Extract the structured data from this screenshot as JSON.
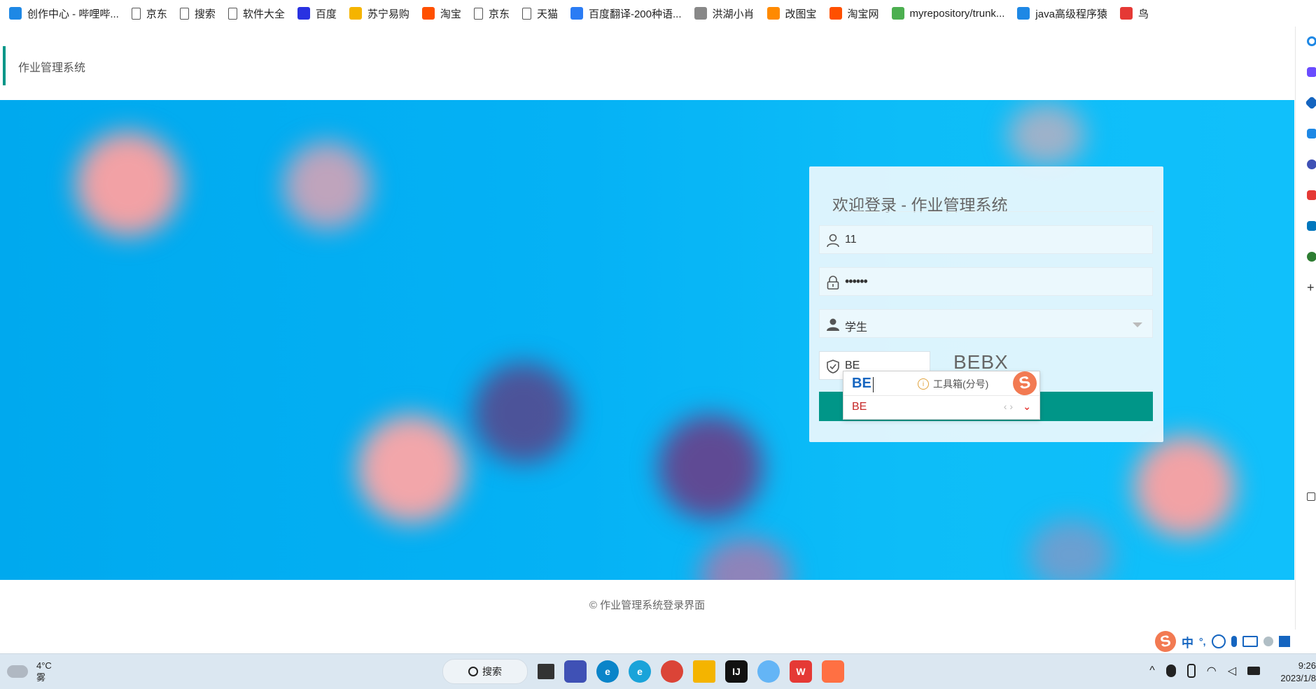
{
  "bookmarks": [
    {
      "label": "创作中心 - 哔哩哔...",
      "icon": "bilibili-icon",
      "color": "#1e88e5"
    },
    {
      "label": "京东",
      "icon": "page-icon"
    },
    {
      "label": "搜索",
      "icon": "page-icon"
    },
    {
      "label": "软件大全",
      "icon": "page-icon"
    },
    {
      "label": "百度",
      "icon": "baidu-paw-icon",
      "color": "#2932e1"
    },
    {
      "label": "苏宁易购",
      "icon": "suning-icon",
      "color": "#f5b400"
    },
    {
      "label": "淘宝",
      "icon": "taobao-icon",
      "color": "#ff5000"
    },
    {
      "label": "京东",
      "icon": "page-icon"
    },
    {
      "label": "天猫",
      "icon": "page-icon"
    },
    {
      "label": "百度翻译-200种语...",
      "icon": "baidu-translate-icon",
      "color": "#2b7cf4"
    },
    {
      "label": "洪湖小肖",
      "icon": "feather-icon",
      "color": "#888888"
    },
    {
      "label": "改图宝",
      "icon": "gaitubao-icon",
      "color": "#ff8a00"
    },
    {
      "label": "淘宝网",
      "icon": "taobao-icon",
      "color": "#ff5000"
    },
    {
      "label": "myrepository/trunk...",
      "icon": "chrome-icon",
      "color": "#4caf50"
    },
    {
      "label": "java高级程序猿",
      "icon": "bilibili-icon",
      "color": "#1e88e5"
    },
    {
      "label": "鸟",
      "icon": "bird-icon",
      "color": "#e53935"
    }
  ],
  "app": {
    "title": "作业管理系统"
  },
  "login": {
    "heading": "欢迎登录 - 作业管理系统",
    "username": "11",
    "password": "••••••",
    "role": "学生",
    "captcha_value": "BE",
    "captcha_image_text": "BEBX"
  },
  "ime_popup": {
    "composition": "BE",
    "toolbox_label": "工具箱(分号)",
    "candidate": "BE",
    "nav": "‹ ›",
    "more": "⌄"
  },
  "footer": {
    "copyright": "© 作业管理系统登录界面"
  },
  "ime_status": {
    "mode": "中",
    "punct": "°,"
  },
  "taskbar": {
    "temperature": "4°C",
    "weather": "雾",
    "search_label": "搜索",
    "time": "9:26",
    "date": "2023/1/8"
  },
  "colors": {
    "accent": "#009688",
    "banner": "#05b2f5"
  }
}
